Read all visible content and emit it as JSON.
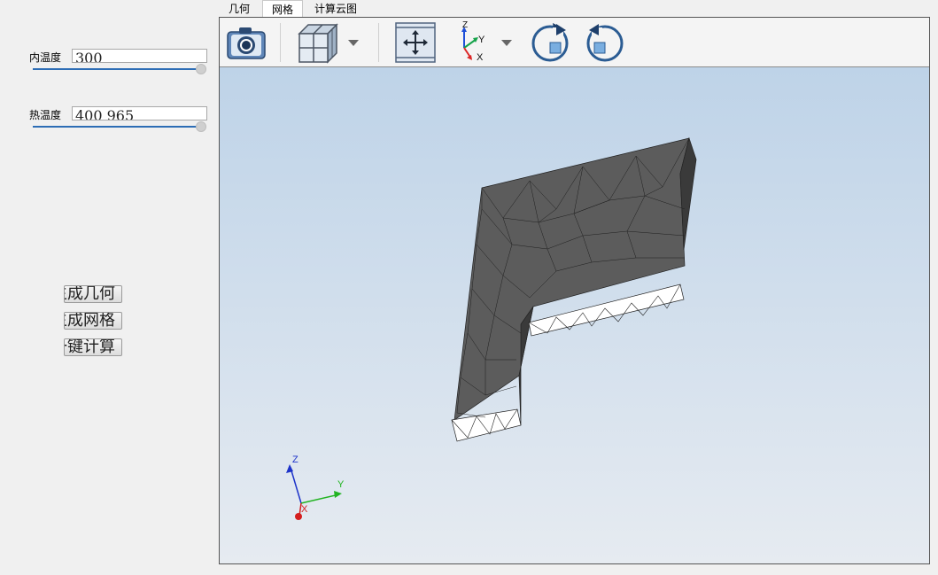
{
  "params": {
    "inner_temp": {
      "label": "内温度",
      "value": "300"
    },
    "hot_temp": {
      "label": "热温度",
      "value": "400 965"
    }
  },
  "actions": {
    "gen_geometry": "生成几何",
    "gen_mesh": "生成网格",
    "one_click_compute": "一键计算"
  },
  "tabs": [
    "几何",
    "网格",
    "计算云图"
  ],
  "active_tab": "网格",
  "axis_triad": {
    "x": "X",
    "y": "Y",
    "z": "Z"
  },
  "toolbar_icons": [
    "camera-icon",
    "display-mode-icon",
    "fit-view-icon",
    "axes-orientation-icon",
    "rotate-clockwise-icon",
    "rotate-counterclockwise-icon"
  ]
}
